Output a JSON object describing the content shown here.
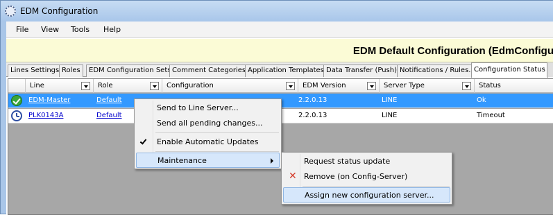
{
  "window": {
    "title": "EDM Configuration"
  },
  "menu": [
    "File",
    "View",
    "Tools",
    "Help"
  ],
  "header": {
    "title": "EDM Default Configuration (EdmConfigu"
  },
  "tabs": [
    "Lines Settings",
    "Roles",
    "EDM Configuration Sets",
    "Comment Categories",
    "Application Templates",
    "Data Transfer (Push)",
    "Notifications / Rules...",
    "Configuration Status"
  ],
  "active_tab": "Configuration Status",
  "grid": {
    "columns": [
      "Line",
      "Role",
      "Configuration",
      "EDM Version",
      "Server Type",
      "Status"
    ],
    "rows": [
      {
        "icon": "ok-check-icon",
        "line": "EDM-Master",
        "role": "Default",
        "configuration": "",
        "edm_version": "2.2.0.13",
        "server_type": "LINE",
        "status": "Ok",
        "selected": true
      },
      {
        "icon": "clock-icon",
        "line": "PLK0143A",
        "role": "Default",
        "configuration": "",
        "edm_version": "2.2.0.13",
        "server_type": "LINE",
        "status": "Timeout",
        "selected": false
      }
    ]
  },
  "context_menu": {
    "items": [
      "Send to Line Server...",
      "Send all pending changes...",
      "Enable Automatic Updates",
      "Maintenance"
    ],
    "checked_item": "Enable Automatic Updates",
    "highlighted_item": "Maintenance"
  },
  "submenu": {
    "items": [
      "Request status update",
      "Remove (on Config-Server)",
      "Assign new configuration server..."
    ],
    "highlighted_item": "Assign new configuration server..."
  },
  "colors": {
    "selection": "#3399ff",
    "header_band": "#fbfbd6",
    "menu_highlight": "#d6e7fb"
  }
}
